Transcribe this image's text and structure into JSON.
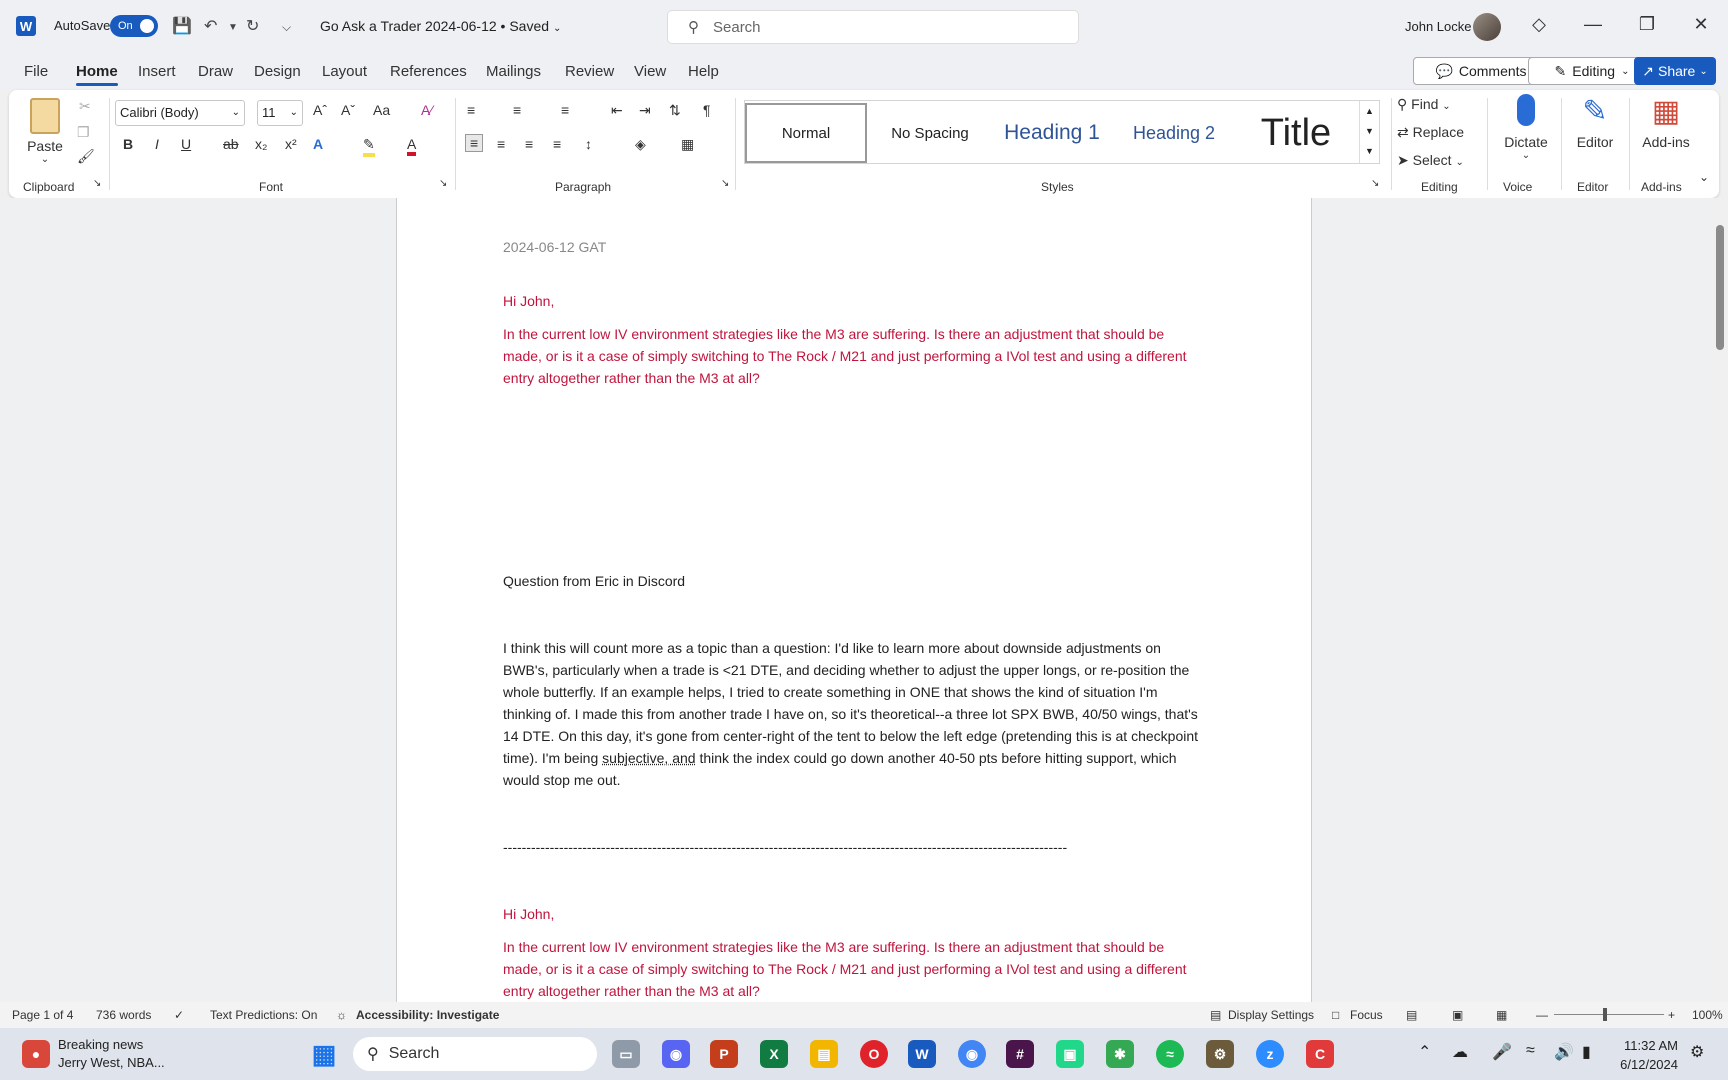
{
  "titlebar": {
    "autosave_label": "AutoSave",
    "autosave_state": "On",
    "doc_title": "Go Ask a Trader 2024-06-12 • Saved",
    "search_placeholder": "Search",
    "user_name": "John Locke"
  },
  "menu": {
    "tabs": [
      "File",
      "Home",
      "Insert",
      "Draw",
      "Design",
      "Layout",
      "References",
      "Mailings",
      "Review",
      "View",
      "Help"
    ],
    "comments": "Comments",
    "editing": "Editing",
    "share": "Share"
  },
  "ribbon": {
    "paste": "Paste",
    "clipboard": "Clipboard",
    "font_name": "Calibri (Body)",
    "font_size": "11",
    "font": "Font",
    "paragraph": "Paragraph",
    "styles": "Styles",
    "style_normal": "Normal",
    "style_nospacing": "No Spacing",
    "style_h1": "Heading 1",
    "style_h2": "Heading 2",
    "style_title": "Title",
    "find": "Find",
    "replace": "Replace",
    "select": "Select",
    "editing": "Editing",
    "dictate": "Dictate",
    "voice": "Voice",
    "editor": "Editor",
    "editor_group": "Editor",
    "addins": "Add-ins",
    "addins_group": "Add-ins"
  },
  "doc": {
    "date_line": "2024-06-12 GAT",
    "greeting": "Hi John,",
    "q1": "In the current low IV environment strategies like the M3 are suffering. Is there an adjustment that should be made, or is it a case of simply switching to The Rock / M21 and just performing a IVol test and using a different entry altogether rather than the M3 at all?",
    "q2_heading": "Question from Eric in Discord",
    "q2_part1": "I think this will count more as a topic than a question: I'd like to learn more about downside adjustments on BWB's, particularly when a trade is <21 DTE, and deciding whether to adjust the upper longs, or re-position the whole butterfly. If an example helps, I tried to create something in ONE that shows the kind of situation I'm thinking of. I made this from another trade I have on, so it's theoretical--a three lot SPX BWB, 40/50 wings, that's 14 DTE. On this day, it's gone from center-right of the tent to below the left edge (pretending this is at checkpoint time). I'm being ",
    "q2_underlined": "subjective, and",
    "q2_part2": " think the index could go down another 40-50 pts before hitting support, which would stop me out.",
    "divider": "-------------------------------------------------------------------------------------------------------------------------",
    "greeting2": "Hi John,",
    "q3": "In the current low IV environment strategies like the M3 are suffering. Is there an adjustment that should be made, or is it a case of simply switching to The Rock / M21 and just performing a IVol test and using a different entry altogether rather than the M3 at all?"
  },
  "status": {
    "page": "Page 1 of 4",
    "words": "736 words",
    "predictions": "Text Predictions: On",
    "accessibility": "Accessibility: Investigate",
    "display": "Display Settings",
    "focus": "Focus",
    "zoom": "100%"
  },
  "taskbar": {
    "news_title": "Breaking news",
    "news_sub": "Jerry West, NBA...",
    "search": "Search",
    "time": "11:32 AM",
    "date": "6/12/2024"
  },
  "colors": {
    "accent": "#185abd",
    "question_red": "#c0143c"
  }
}
